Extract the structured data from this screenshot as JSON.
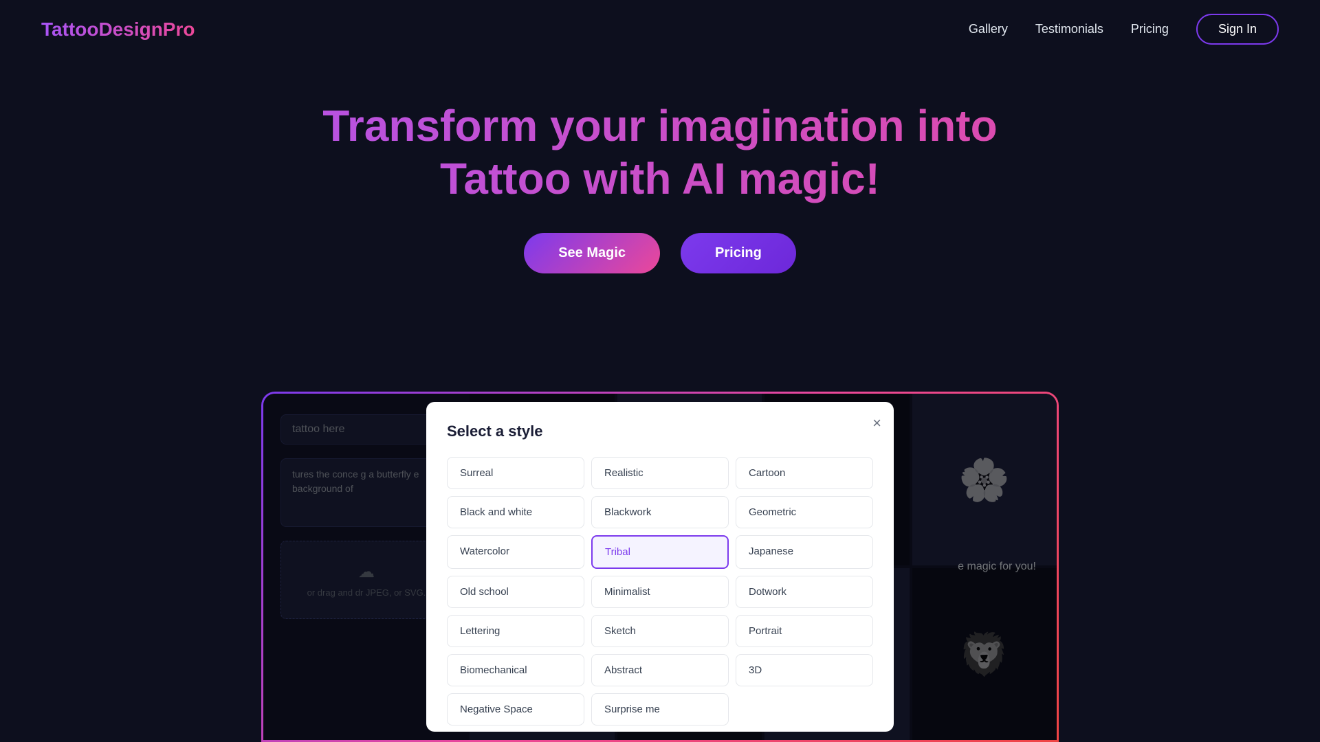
{
  "nav": {
    "logo": "TattooDesignPro",
    "links": [
      {
        "label": "Gallery",
        "name": "gallery-link"
      },
      {
        "label": "Testimonials",
        "name": "testimonials-link"
      },
      {
        "label": "Pricing",
        "name": "pricing-link"
      }
    ],
    "sign_in": "Sign In"
  },
  "hero": {
    "line1": "Transform your imagination into",
    "line2": "Tattoo with AI magic!",
    "btn_magic": "See Magic",
    "btn_pricing": "Pricing"
  },
  "app": {
    "input_placeholder": "tattoo here",
    "textarea_text": "tures the conce\ng a butterfly e\nbackground of",
    "upload_text": "or drag and dr\nJPEG, or SVG.",
    "magic_text": "e magic for you!"
  },
  "modal": {
    "title": "Select a style",
    "close_label": "×",
    "styles": [
      {
        "label": "Surreal",
        "name": "style-surreal",
        "selected": false
      },
      {
        "label": "Realistic",
        "name": "style-realistic",
        "selected": false
      },
      {
        "label": "Cartoon",
        "name": "style-cartoon",
        "selected": false
      },
      {
        "label": "Black and white",
        "name": "style-black-white",
        "selected": false
      },
      {
        "label": "Blackwork",
        "name": "style-blackwork",
        "selected": false
      },
      {
        "label": "Geometric",
        "name": "style-geometric",
        "selected": false
      },
      {
        "label": "Watercolor",
        "name": "style-watercolor",
        "selected": false
      },
      {
        "label": "Tribal",
        "name": "style-tribal",
        "selected": true
      },
      {
        "label": "Japanese",
        "name": "style-japanese",
        "selected": false
      },
      {
        "label": "Old school",
        "name": "style-old-school",
        "selected": false
      },
      {
        "label": "Minimalist",
        "name": "style-minimalist",
        "selected": false
      },
      {
        "label": "Dotwork",
        "name": "style-dotwork",
        "selected": false
      },
      {
        "label": "Lettering",
        "name": "style-lettering",
        "selected": false
      },
      {
        "label": "Sketch",
        "name": "style-sketch",
        "selected": false
      },
      {
        "label": "Portrait",
        "name": "style-portrait",
        "selected": false
      },
      {
        "label": "Biomechanical",
        "name": "style-biomechanical",
        "selected": false
      },
      {
        "label": "Abstract",
        "name": "style-abstract",
        "selected": false
      },
      {
        "label": "3D",
        "name": "style-3d",
        "selected": false
      },
      {
        "label": "Negative Space",
        "name": "style-negative-space",
        "selected": false
      },
      {
        "label": "Surprise me",
        "name": "style-surprise-me",
        "selected": false
      }
    ]
  }
}
